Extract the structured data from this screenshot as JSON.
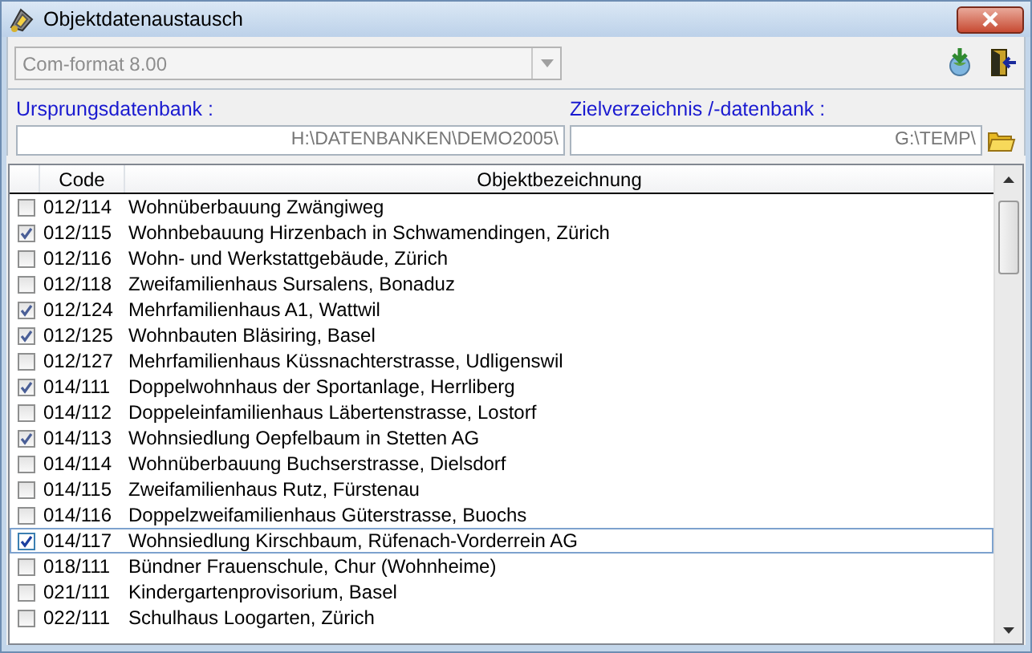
{
  "window": {
    "title": "Objektdatenaustausch"
  },
  "format_combo": {
    "value": "Com-format 8.00",
    "disabled": true
  },
  "source_db": {
    "label": "Ursprungsdatenbank :",
    "value": "H:\\DATENBANKEN\\DEMO2005\\"
  },
  "target_dir": {
    "label": "Zielverzeichnis /-datenbank :",
    "value": "G:\\TEMP\\"
  },
  "table": {
    "columns": [
      "Code",
      "Objektbezeichnung"
    ],
    "rows": [
      {
        "code": "012/114",
        "name": "Wohnüberbauung Zwängiweg",
        "checked": false,
        "selected": false
      },
      {
        "code": "012/115",
        "name": "Wohnbebauung Hirzenbach in Schwamendingen, Zürich",
        "checked": true,
        "selected": false
      },
      {
        "code": "012/116",
        "name": "Wohn- und Werkstattgebäude, Zürich",
        "checked": false,
        "selected": false
      },
      {
        "code": "012/118",
        "name": "Zweifamilienhaus Sursalens, Bonaduz",
        "checked": false,
        "selected": false
      },
      {
        "code": "012/124",
        "name": "Mehrfamilienhaus A1, Wattwil",
        "checked": true,
        "selected": false
      },
      {
        "code": "012/125",
        "name": "Wohnbauten Bläsiring, Basel",
        "checked": true,
        "selected": false
      },
      {
        "code": "012/127",
        "name": "Mehrfamilienhaus Küssnachterstrasse, Udligenswil",
        "checked": false,
        "selected": false
      },
      {
        "code": "014/111",
        "name": "Doppelwohnhaus der Sportanlage, Herrliberg",
        "checked": true,
        "selected": false
      },
      {
        "code": "014/112",
        "name": "Doppeleinfamilienhaus Läbertenstrasse, Lostorf",
        "checked": false,
        "selected": false
      },
      {
        "code": "014/113",
        "name": "Wohnsiedlung Oepfelbaum in Stetten AG",
        "checked": true,
        "selected": false
      },
      {
        "code": "014/114",
        "name": "Wohnüberbauung Buchserstrasse, Dielsdorf",
        "checked": false,
        "selected": false
      },
      {
        "code": "014/115",
        "name": "Zweifamilienhaus Rutz, Fürstenau",
        "checked": false,
        "selected": false
      },
      {
        "code": "014/116",
        "name": "Doppelzweifamilienhaus Güterstrasse, Buochs",
        "checked": false,
        "selected": false
      },
      {
        "code": "014/117",
        "name": "Wohnsiedlung Kirschbaum, Rüfenach-Vorderrein AG",
        "checked": true,
        "selected": true
      },
      {
        "code": "018/111",
        "name": "Bündner Frauenschule, Chur (Wohnheime)",
        "checked": false,
        "selected": false
      },
      {
        "code": "021/111",
        "name": "Kindergartenprovisorium, Basel",
        "checked": false,
        "selected": false
      },
      {
        "code": "022/111",
        "name": "Schulhaus Loogarten, Zürich",
        "checked": false,
        "selected": false
      }
    ]
  }
}
